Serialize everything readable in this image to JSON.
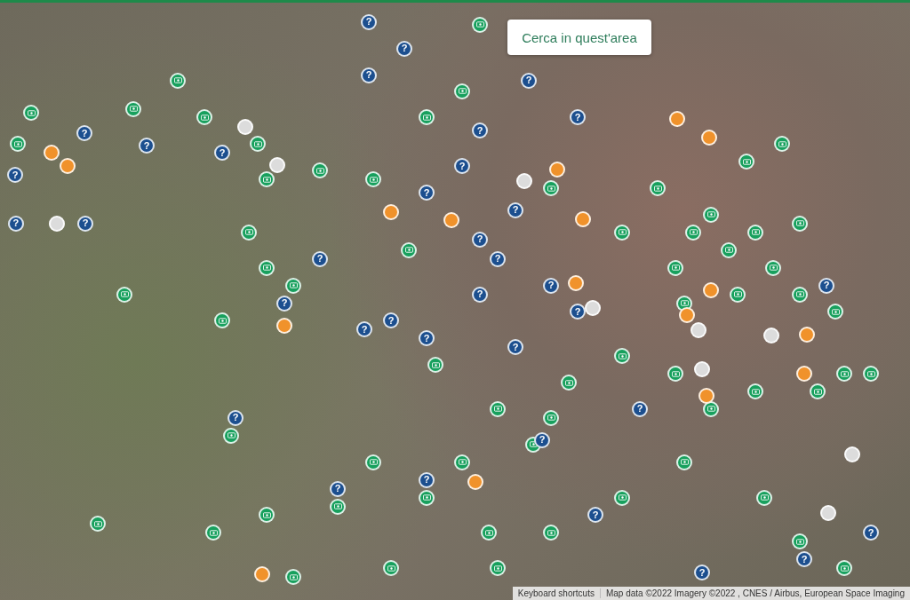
{
  "search_button": {
    "label": "Cerca in quest'area"
  },
  "markers": [
    {
      "kind": "listing"
    },
    {
      "kind": "listing"
    },
    {
      "kind": "listing"
    },
    {
      "kind": "listing"
    },
    {
      "kind": "listing"
    },
    {
      "kind": "listing"
    },
    {
      "kind": "listing"
    },
    {
      "kind": "listing"
    },
    {
      "kind": "listing"
    },
    {
      "kind": "listing"
    },
    {
      "kind": "listing"
    },
    {
      "kind": "listing"
    },
    {
      "kind": "listing"
    },
    {
      "kind": "listing"
    },
    {
      "kind": "listing"
    },
    {
      "kind": "listing"
    },
    {
      "kind": "listing"
    },
    {
      "kind": "listing"
    },
    {
      "kind": "listing"
    },
    {
      "kind": "listing"
    },
    {
      "kind": "listing"
    },
    {
      "kind": "listing"
    },
    {
      "kind": "listing"
    },
    {
      "kind": "listing"
    },
    {
      "kind": "listing"
    },
    {
      "kind": "listing"
    },
    {
      "kind": "listing"
    },
    {
      "kind": "listing"
    },
    {
      "kind": "listing"
    },
    {
      "kind": "listing"
    },
    {
      "kind": "listing"
    },
    {
      "kind": "listing"
    },
    {
      "kind": "listing"
    },
    {
      "kind": "listing"
    },
    {
      "kind": "listing"
    },
    {
      "kind": "listing"
    },
    {
      "kind": "listing"
    },
    {
      "kind": "listing"
    },
    {
      "kind": "listing"
    },
    {
      "kind": "listing"
    },
    {
      "kind": "listing"
    },
    {
      "kind": "listing"
    },
    {
      "kind": "listing"
    },
    {
      "kind": "listing"
    },
    {
      "kind": "listing"
    },
    {
      "kind": "listing"
    },
    {
      "kind": "listing"
    },
    {
      "kind": "listing"
    },
    {
      "kind": "listing"
    },
    {
      "kind": "listing"
    },
    {
      "kind": "listing"
    },
    {
      "kind": "listing"
    },
    {
      "kind": "listing"
    },
    {
      "kind": "listing"
    },
    {
      "kind": "listing"
    },
    {
      "kind": "listing"
    },
    {
      "kind": "listing"
    },
    {
      "kind": "listing"
    },
    {
      "kind": "listing"
    },
    {
      "kind": "listing"
    },
    {
      "kind": "listing"
    },
    {
      "kind": "listing"
    },
    {
      "kind": "listing"
    },
    {
      "kind": "listing"
    },
    {
      "kind": "unknown",
      "label": "?"
    },
    {
      "kind": "unknown",
      "label": "?"
    },
    {
      "kind": "unknown",
      "label": "?"
    },
    {
      "kind": "unknown",
      "label": "?"
    },
    {
      "kind": "unknown",
      "label": "?"
    },
    {
      "kind": "unknown",
      "label": "?"
    },
    {
      "kind": "unknown",
      "label": "?"
    },
    {
      "kind": "unknown",
      "label": "?"
    },
    {
      "kind": "unknown",
      "label": "?"
    },
    {
      "kind": "unknown",
      "label": "?"
    },
    {
      "kind": "unknown",
      "label": "?"
    },
    {
      "kind": "unknown",
      "label": "?"
    },
    {
      "kind": "unknown",
      "label": "?"
    },
    {
      "kind": "unknown",
      "label": "?"
    },
    {
      "kind": "unknown",
      "label": "?"
    },
    {
      "kind": "unknown",
      "label": "?"
    },
    {
      "kind": "unknown",
      "label": "?"
    },
    {
      "kind": "unknown",
      "label": "?"
    },
    {
      "kind": "unknown",
      "label": "?"
    },
    {
      "kind": "unknown",
      "label": "?"
    },
    {
      "kind": "unknown",
      "label": "?"
    },
    {
      "kind": "unknown",
      "label": "?"
    },
    {
      "kind": "unknown",
      "label": "?"
    },
    {
      "kind": "unknown",
      "label": "?"
    },
    {
      "kind": "unknown",
      "label": "?"
    },
    {
      "kind": "unknown",
      "label": "?"
    },
    {
      "kind": "unknown",
      "label": "?"
    },
    {
      "kind": "unknown",
      "label": "?"
    },
    {
      "kind": "unknown",
      "label": "?"
    },
    {
      "kind": "unknown",
      "label": "?"
    },
    {
      "kind": "unknown",
      "label": "?"
    },
    {
      "kind": "unknown",
      "label": "?"
    },
    {
      "kind": "unknown",
      "label": "?"
    },
    {
      "kind": "unknown",
      "label": "?"
    },
    {
      "kind": "unknown",
      "label": "?"
    },
    {
      "kind": "unknown",
      "label": "?"
    },
    {
      "kind": "pending"
    },
    {
      "kind": "pending"
    },
    {
      "kind": "pending"
    },
    {
      "kind": "pending"
    },
    {
      "kind": "pending"
    },
    {
      "kind": "pending"
    },
    {
      "kind": "pending"
    },
    {
      "kind": "pending"
    },
    {
      "kind": "pending"
    },
    {
      "kind": "pending"
    },
    {
      "kind": "pending"
    },
    {
      "kind": "pending"
    },
    {
      "kind": "pending"
    },
    {
      "kind": "pending"
    },
    {
      "kind": "pending"
    },
    {
      "kind": "pending"
    },
    {
      "kind": "pending"
    },
    {
      "kind": "inactive"
    },
    {
      "kind": "inactive"
    },
    {
      "kind": "inactive"
    },
    {
      "kind": "inactive"
    },
    {
      "kind": "inactive"
    },
    {
      "kind": "inactive"
    },
    {
      "kind": "inactive"
    },
    {
      "kind": "inactive"
    },
    {
      "kind": "inactive"
    },
    {
      "kind": "inactive"
    }
  ],
  "attribution": {
    "keyboard_shortcuts": "Keyboard shortcuts",
    "map_data": "Map data ©2022 Imagery ©2022 , CNES / Airbus, European Space Imaging"
  }
}
